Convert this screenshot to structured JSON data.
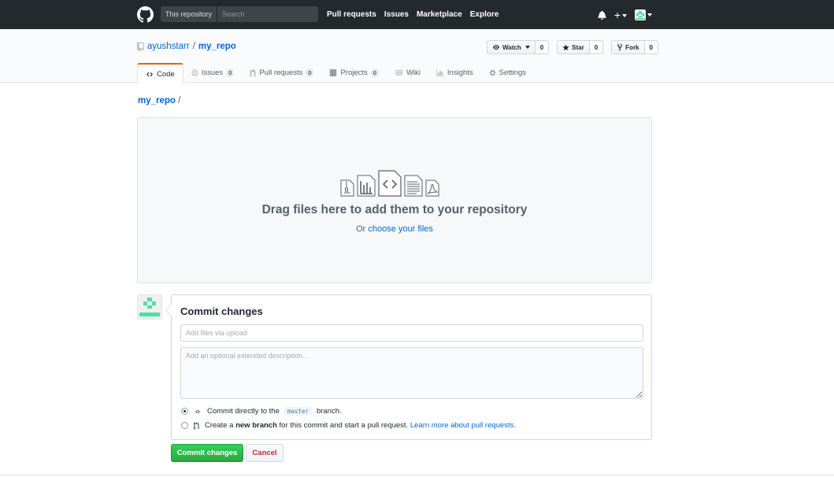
{
  "header": {
    "scope_label": "This repository",
    "search_placeholder": "Search",
    "nav": [
      "Pull requests",
      "Issues",
      "Marketplace",
      "Explore"
    ],
    "new_label": "+"
  },
  "repo": {
    "owner": "ayushstarr",
    "separator": "/",
    "name": "my_repo",
    "actions": {
      "watch_label": "Watch",
      "watch_count": "0",
      "star_label": "Star",
      "star_count": "0",
      "fork_label": "Fork",
      "fork_count": "0"
    },
    "tabs": [
      {
        "label": "Code",
        "count": ""
      },
      {
        "label": "Issues",
        "count": "0"
      },
      {
        "label": "Pull requests",
        "count": "0"
      },
      {
        "label": "Projects",
        "count": "0"
      },
      {
        "label": "Wiki",
        "count": ""
      },
      {
        "label": "Insights",
        "count": ""
      },
      {
        "label": "Settings",
        "count": ""
      }
    ]
  },
  "breadcrumb": {
    "repo": "my_repo",
    "separator": "/"
  },
  "upload": {
    "title": "Drag files here to add them to your repository",
    "or_text": "Or",
    "choose_link": "choose your files"
  },
  "commit": {
    "title": "Commit changes",
    "summary_placeholder": "Add files via upload",
    "description_placeholder": "Add an optional extended description…",
    "option_direct_prefix": "Commit directly to the",
    "branch": "master",
    "option_direct_suffix": "branch.",
    "option_new_prefix": "Create a",
    "option_new_bold": "new branch",
    "option_new_middle": "for this commit and start a pull request.",
    "option_new_link": "Learn more about pull requests.",
    "submit_label": "Commit changes",
    "cancel_label": "Cancel"
  },
  "colors": {
    "header_bg": "#24292e",
    "link": "#0366d6",
    "primary": "#28a745",
    "danger": "#cb2431",
    "tab_accent": "#e36209"
  }
}
